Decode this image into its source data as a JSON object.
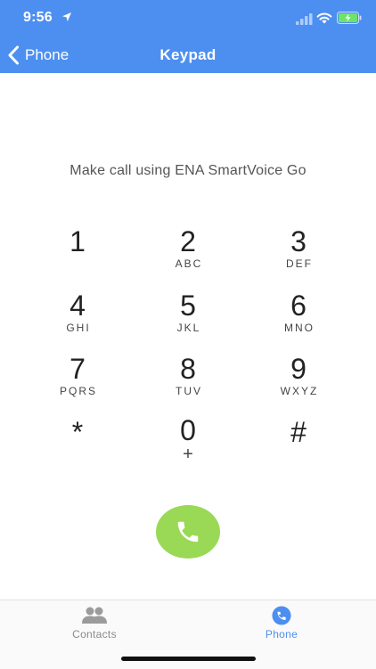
{
  "colors": {
    "header_bg": "#4d8ff0",
    "accent": "#4d8ff0",
    "call_green": "#9ad955"
  },
  "status_bar": {
    "time": "9:56",
    "icons": [
      "location-arrow-icon",
      "cellular-signal-icon",
      "wifi-icon",
      "battery-charging-icon"
    ]
  },
  "nav": {
    "back_label": "Phone",
    "title": "Keypad"
  },
  "prompt": "Make call using ENA SmartVoice Go",
  "keypad": [
    {
      "digit": "1",
      "letters": ""
    },
    {
      "digit": "2",
      "letters": "ABC"
    },
    {
      "digit": "3",
      "letters": "DEF"
    },
    {
      "digit": "4",
      "letters": "GHI"
    },
    {
      "digit": "5",
      "letters": "JKL"
    },
    {
      "digit": "6",
      "letters": "MNO"
    },
    {
      "digit": "7",
      "letters": "PQRS"
    },
    {
      "digit": "8",
      "letters": "TUV"
    },
    {
      "digit": "9",
      "letters": "WXYZ"
    },
    {
      "digit": "*",
      "letters": ""
    },
    {
      "digit": "0",
      "letters": "+"
    },
    {
      "digit": "#",
      "letters": ""
    }
  ],
  "call_button": {
    "icon": "phone-handset-icon"
  },
  "tabs": [
    {
      "label": "Contacts",
      "icon": "contacts-people-icon",
      "selected": false
    },
    {
      "label": "Phone",
      "icon": "phone-circle-icon",
      "selected": true
    }
  ]
}
